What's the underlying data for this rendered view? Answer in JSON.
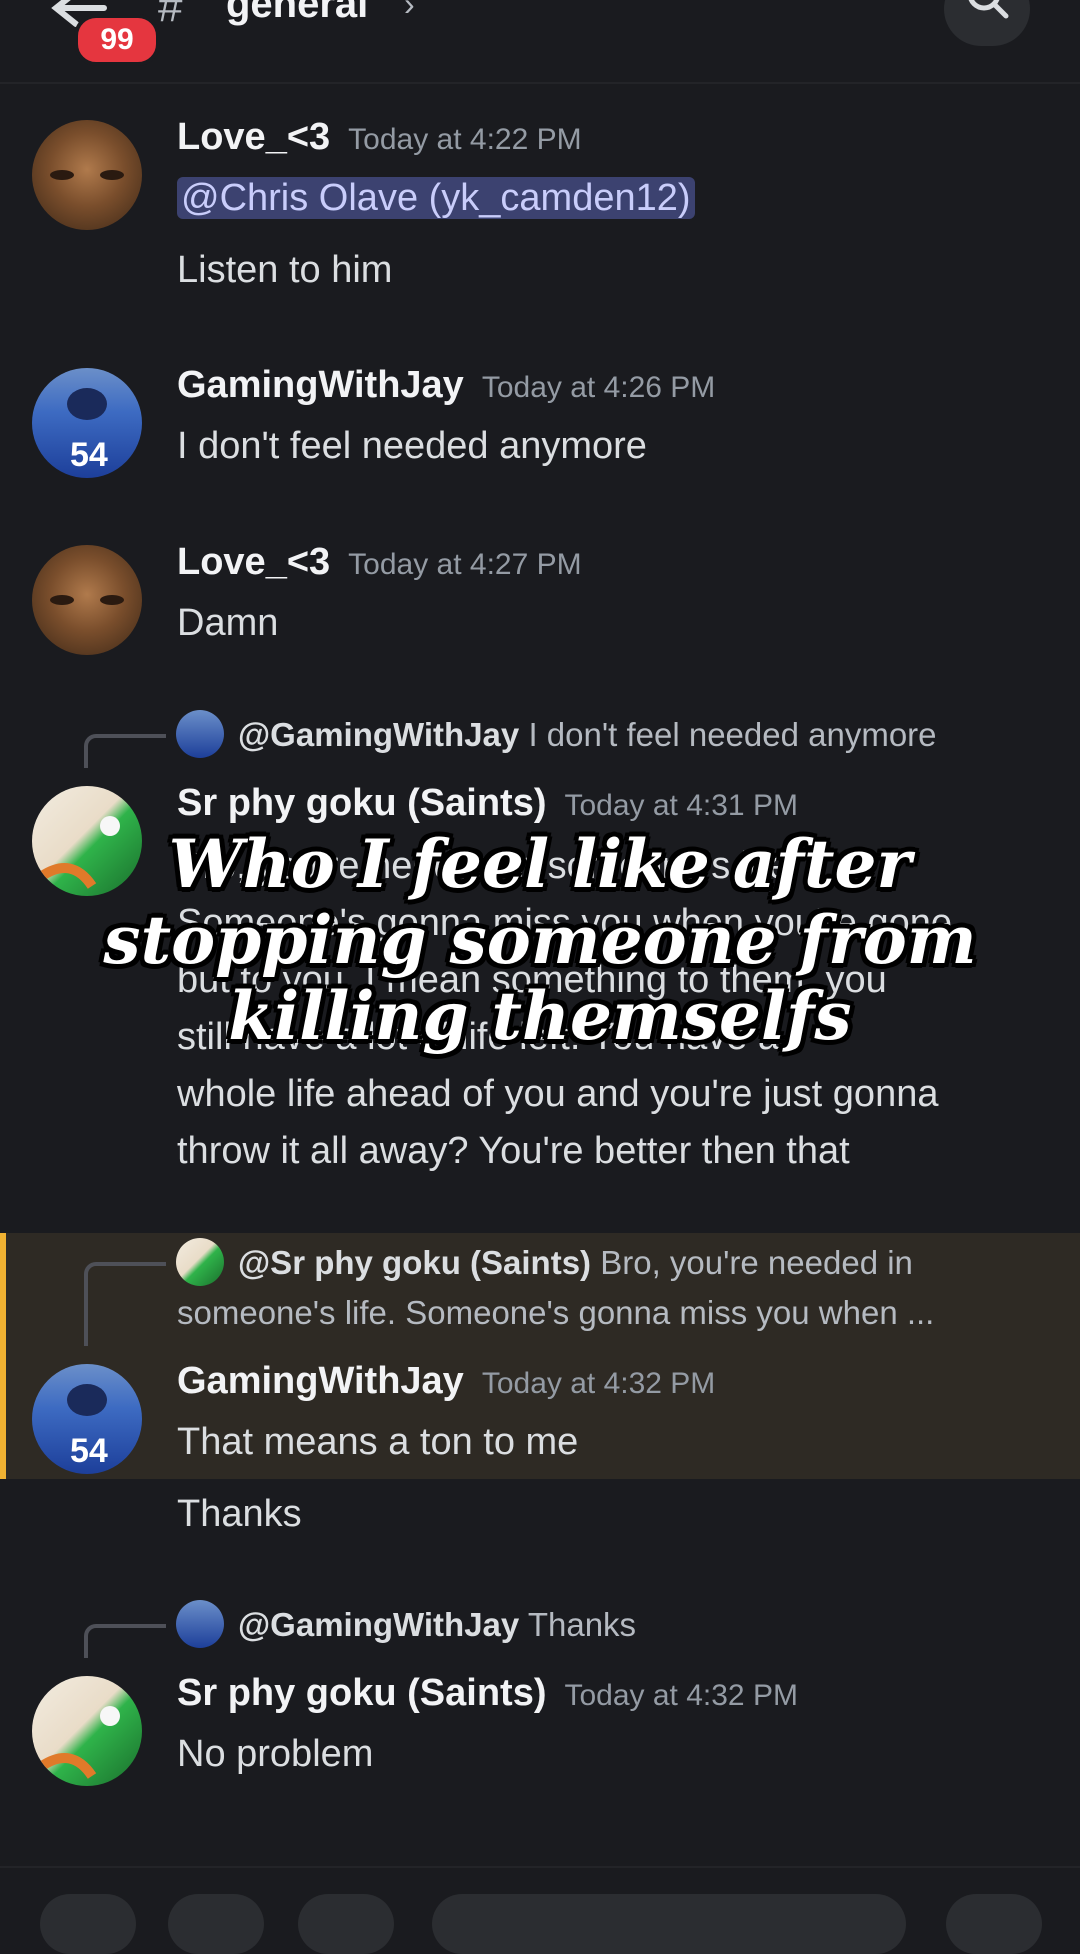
{
  "header": {
    "unread_count": "99",
    "channel_hash": "#",
    "channel_name": "general",
    "channel_chevron": "›"
  },
  "messages": [
    {
      "author": "Love_<3",
      "time": "Today at 4:22 PM",
      "mention": "@Chris Olave (yk_camden12)",
      "lines": [
        "Listen to him"
      ]
    },
    {
      "author": "GamingWithJay",
      "time": "Today at 4:26 PM",
      "lines": [
        "I don't feel needed anymore"
      ]
    },
    {
      "author": "Love_<3",
      "time": "Today at 4:27 PM",
      "lines": [
        "Damn"
      ]
    },
    {
      "author": "Sr phy goku (Saints)",
      "time": "Today at 4:31 PM",
      "reply": {
        "user": "@GamingWithJay",
        "text": "I don't feel needed anymore"
      },
      "lines": [
        "Bro, you're needed in someone's life.",
        "Someone's gonna miss you when you're gone",
        "but to you, I mean something to them, you",
        "still have a lot of life left. You have a",
        "whole life ahead of you and you're just gonna",
        "throw it all away? You're better then that"
      ]
    },
    {
      "author": "GamingWithJay",
      "time": "Today at 4:32 PM",
      "reply": {
        "user": "@Sr phy goku (Saints)",
        "text": "Bro, you're needed in",
        "text2": "someone's life. Someone's gonna miss you when ..."
      },
      "lines": [
        "That means a ton to me",
        "Thanks"
      ]
    },
    {
      "author": "Sr phy goku (Saints)",
      "time": "Today at 4:32 PM",
      "reply": {
        "user": "@GamingWithJay",
        "text": "Thanks"
      },
      "lines": [
        "No problem"
      ]
    }
  ],
  "overlay_caption": "Who I feel like after\nstopping someone from\nkilling themselfs",
  "colors": {
    "accent": "#f0b232",
    "badge": "#e5363f",
    "mention_bg": "#3c4270"
  }
}
